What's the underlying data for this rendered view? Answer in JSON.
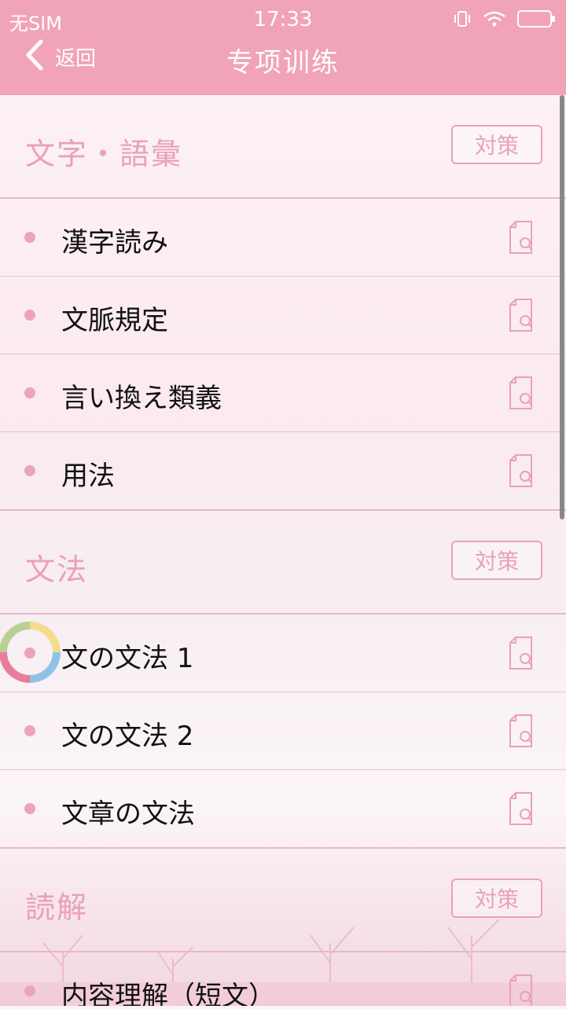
{
  "status_bar": {
    "carrier": "无SIM",
    "time": "17:33"
  },
  "nav": {
    "back_label": "返回",
    "title": "专项训练"
  },
  "sections": [
    {
      "title": "文字・語彙",
      "strategy_label": "対策",
      "items": [
        {
          "label": "漢字読み"
        },
        {
          "label": "文脈規定"
        },
        {
          "label": "言い換え類義"
        },
        {
          "label": "用法"
        }
      ]
    },
    {
      "title": "文法",
      "strategy_label": "対策",
      "items": [
        {
          "label": "文の文法 1"
        },
        {
          "label": "文の文法 2"
        },
        {
          "label": "文章の文法"
        }
      ]
    },
    {
      "title": "読解",
      "strategy_label": "対策",
      "items": [
        {
          "label": "内容理解（短文）"
        }
      ]
    }
  ],
  "colors": {
    "nav_bg": "#f1a3b8",
    "accent": "#eaa1b6",
    "text": "#111111"
  }
}
